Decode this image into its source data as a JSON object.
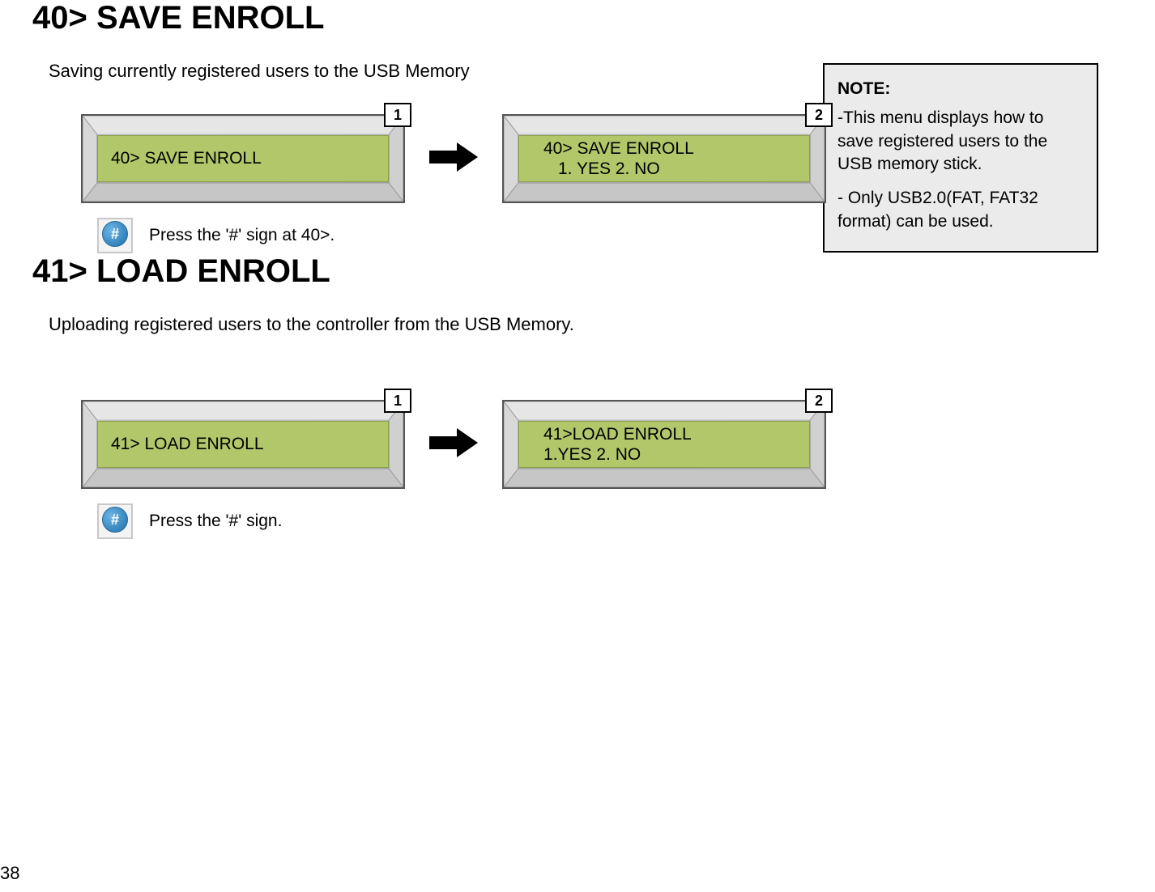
{
  "section1": {
    "title": "40> SAVE ENROLL",
    "desc": "Saving currently registered  users to the USB Memory",
    "lcd1": {
      "badge": "1",
      "line1": "40> SAVE ENROLL"
    },
    "lcd2": {
      "badge": "2",
      "line1": "40> SAVE ENROLL",
      "line2": "1. YES  2. NO"
    },
    "caption": "Press the '#' sign at 40>."
  },
  "section2": {
    "title": "41> LOAD ENROLL",
    "desc": "Uploading registered users to the controller from the USB Memory.",
    "lcd1": {
      "badge": "1",
      "line1": "41> LOAD ENROLL"
    },
    "lcd2": {
      "badge": "2",
      "line1": "41>LOAD ENROLL",
      "line2": "1.YES  2. NO"
    },
    "caption": "Press the '#' sign."
  },
  "note": {
    "title": "NOTE:",
    "line1": "-This menu displays how to save registered users to the USB memory stick.",
    "line2": "- Only USB2.0(FAT, FAT32 format) can be used."
  },
  "hash_glyph": "#",
  "page_number": "38"
}
